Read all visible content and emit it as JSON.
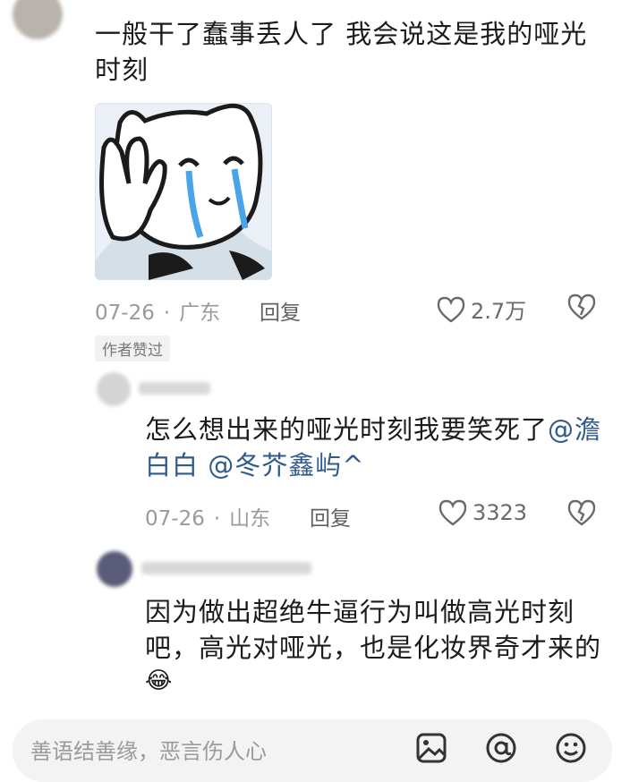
{
  "comment1": {
    "text": "一般干了蠢事丢人了 我会说这是我的哑光时刻",
    "date": "07-26",
    "location": "广东",
    "reply_label": "回复",
    "likes": "2.7万",
    "author_badge": "作者赞过"
  },
  "reply1": {
    "text": "怎么想出来的哑光时刻我要笑死了",
    "mentions": [
      "@澹白白",
      "@冬芥鑫屿^"
    ],
    "date": "07-26",
    "location": "山东",
    "reply_label": "回复",
    "likes": "3323"
  },
  "reply2": {
    "text": "因为做出超绝牛逼行为叫做高光时刻吧，高光对哑光，也是化妆界奇才来的",
    "emoji": "😂"
  },
  "input": {
    "placeholder": "善语结善缘，恶言伤人心"
  },
  "colors": {
    "mention": "#2f5a8a",
    "meta": "#9a9a9a"
  }
}
